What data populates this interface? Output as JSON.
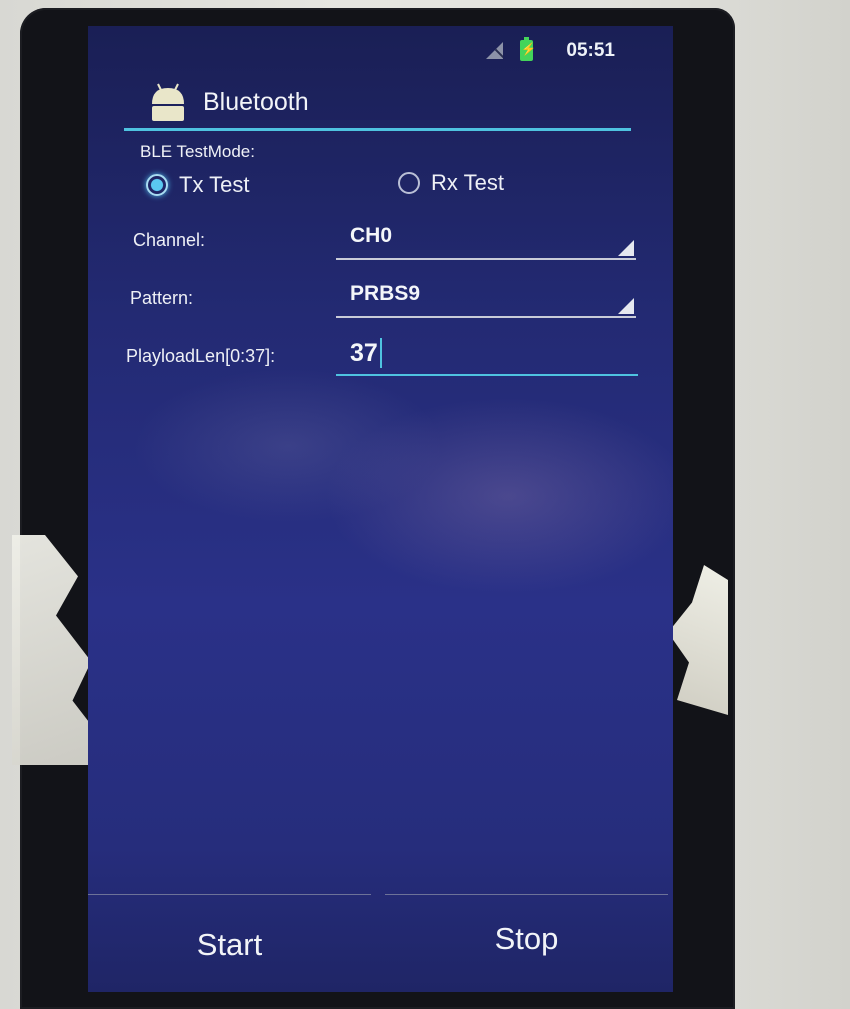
{
  "status_bar": {
    "time": "05:51"
  },
  "action_bar": {
    "title": "Bluetooth"
  },
  "form": {
    "mode_label": "BLE TestMode:",
    "modes": [
      {
        "label": "Tx Test",
        "checked": true
      },
      {
        "label": "Rx Test",
        "checked": false
      }
    ],
    "channel_label": "Channel:",
    "channel_value": "CH0",
    "pattern_label": "Pattern:",
    "pattern_value": "PRBS9",
    "payload_label": "PlayloadLen[0:37]:",
    "payload_value": "37"
  },
  "buttons": {
    "start": "Start",
    "stop": "Stop"
  },
  "colors": {
    "accent": "#4fc3e0",
    "screen_bg": "#262d7c",
    "battery": "#44d45a"
  },
  "icons": [
    "no-signal-icon",
    "battery-charging-icon",
    "android-icon",
    "spinner-arrow-icon"
  ]
}
